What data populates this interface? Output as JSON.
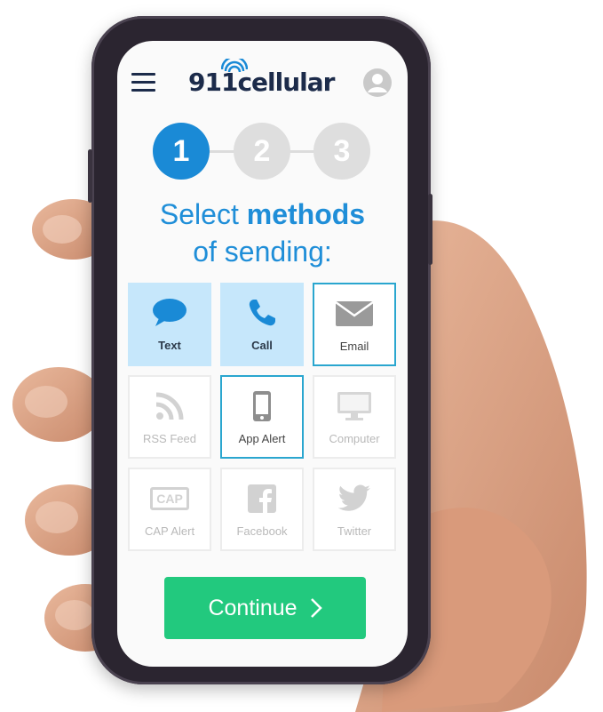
{
  "header": {
    "logo_text": "911cellular",
    "menu_icon": "hamburger-menu-icon",
    "account_icon": "user-avatar-icon"
  },
  "stepper": {
    "steps": [
      "1",
      "2",
      "3"
    ],
    "current": 1
  },
  "heading": {
    "line1_plain": "Select ",
    "line1_bold": "methods",
    "line2": "of sending:"
  },
  "methods": [
    {
      "label": "Text",
      "icon": "chat-bubble-icon",
      "state": "selected"
    },
    {
      "label": "Call",
      "icon": "phone-icon",
      "state": "selected"
    },
    {
      "label": "Email",
      "icon": "envelope-icon",
      "state": "outlined"
    },
    {
      "label": "RSS Feed",
      "icon": "rss-icon",
      "state": "disabled"
    },
    {
      "label": "App Alert",
      "icon": "smartphone-icon",
      "state": "outlined"
    },
    {
      "label": "Computer",
      "icon": "monitor-icon",
      "state": "disabled"
    },
    {
      "label": "CAP Alert",
      "icon": "cap-badge-icon",
      "state": "disabled",
      "badge_text": "CAP"
    },
    {
      "label": "Facebook",
      "icon": "facebook-icon",
      "state": "disabled"
    },
    {
      "label": "Twitter",
      "icon": "twitter-bird-icon",
      "state": "disabled"
    }
  ],
  "continue_button": {
    "label": "Continue",
    "icon": "chevron-right-icon"
  },
  "colors": {
    "brand_blue": "#1a8ad6",
    "selected_tile": "#c6e7fb",
    "outline_tile": "#2aa6cf",
    "continue_green": "#22c97e",
    "logo_navy": "#1c2b4a"
  }
}
